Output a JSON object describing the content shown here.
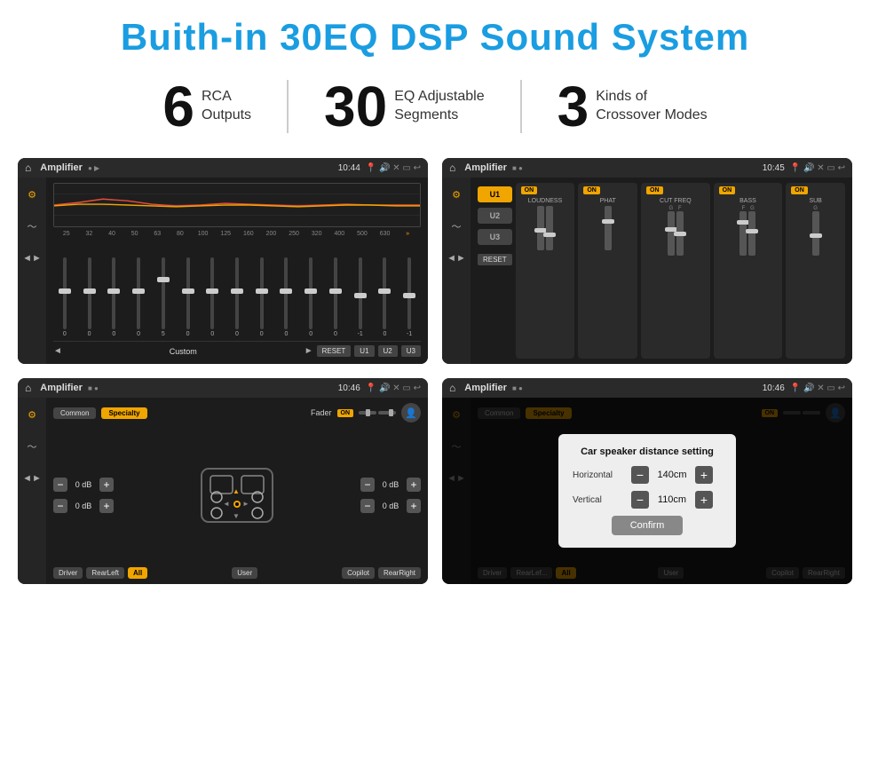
{
  "header": {
    "title": "Buith-in 30EQ DSP Sound System"
  },
  "stats": [
    {
      "number": "6",
      "label": "RCA\nOutputs"
    },
    {
      "number": "30",
      "label": "EQ Adjustable\nSegments"
    },
    {
      "number": "3",
      "label": "Kinds of\nCrossover Modes"
    }
  ],
  "screens": [
    {
      "id": "eq-screen",
      "topbar": {
        "title": "Amplifier",
        "time": "10:44"
      }
    },
    {
      "id": "crossover-screen",
      "topbar": {
        "title": "Amplifier",
        "time": "10:45"
      }
    },
    {
      "id": "fader-screen",
      "topbar": {
        "title": "Amplifier",
        "time": "10:46"
      }
    },
    {
      "id": "dialog-screen",
      "topbar": {
        "title": "Amplifier",
        "time": "10:46"
      },
      "dialog": {
        "title": "Car speaker distance setting",
        "horizontal_label": "Horizontal",
        "horizontal_value": "140cm",
        "vertical_label": "Vertical",
        "vertical_value": "110cm",
        "confirm_label": "Confirm"
      }
    }
  ],
  "eq": {
    "frequencies": [
      "25",
      "32",
      "40",
      "50",
      "63",
      "80",
      "100",
      "125",
      "160",
      "200",
      "250",
      "320",
      "400",
      "500",
      "630"
    ],
    "values": [
      "0",
      "0",
      "0",
      "0",
      "5",
      "0",
      "0",
      "0",
      "0",
      "0",
      "0",
      "0",
      "-1",
      "0",
      "-1"
    ],
    "preset": "Custom",
    "buttons": [
      "RESET",
      "U1",
      "U2",
      "U3"
    ]
  },
  "crossover": {
    "presets": [
      "U1",
      "U2",
      "U3"
    ],
    "modules": [
      "LOUDNESS",
      "PHAT",
      "CUT FREQ",
      "BASS",
      "SUB"
    ],
    "reset": "RESET"
  },
  "fader": {
    "tabs": [
      "Common",
      "Specialty"
    ],
    "fader_label": "Fader",
    "on_label": "ON",
    "positions": [
      "Driver",
      "RearLeft",
      "All",
      "Copilot",
      "RearRight"
    ],
    "active_position": "All",
    "vol_values": [
      "0 dB",
      "0 dB",
      "0 dB",
      "0 dB"
    ],
    "user_btn": "User"
  },
  "dialog": {
    "title": "Car speaker distance setting",
    "horizontal_label": "Horizontal",
    "horizontal_value": "140cm",
    "vertical_label": "Vertical",
    "vertical_value": "110cm",
    "confirm_label": "Confirm"
  }
}
